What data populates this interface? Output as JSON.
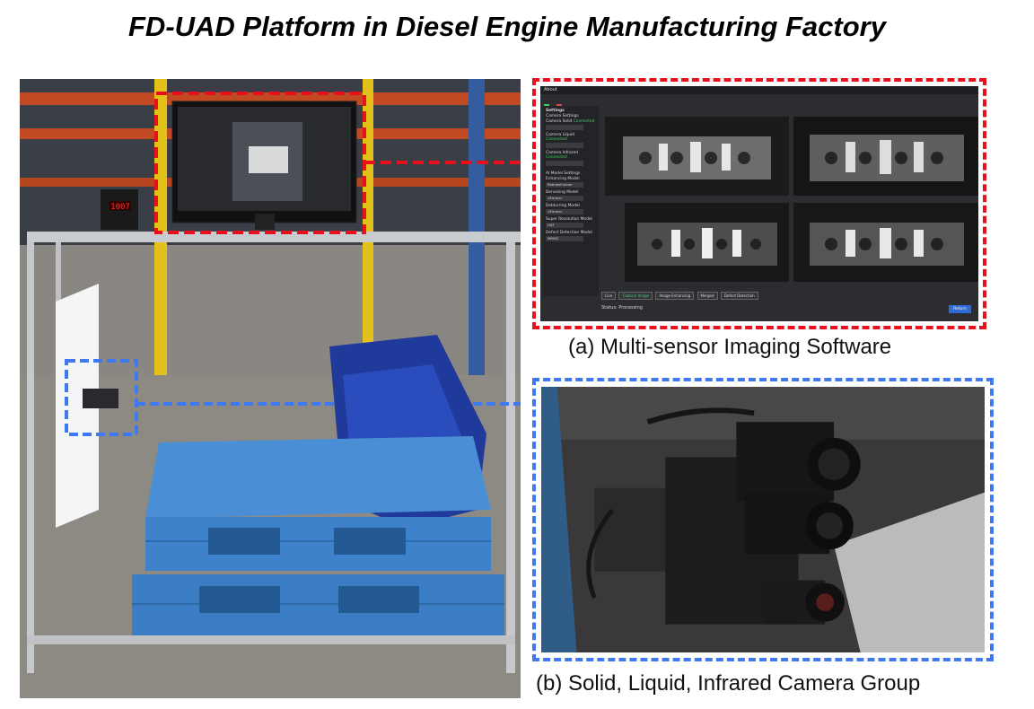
{
  "title": "FD-UAD Platform in Diesel Engine Manufacturing Factory",
  "captions": {
    "a": "(a) Multi-sensor Imaging Software",
    "b": "(b) Solid, Liquid, Infrared Camera Group"
  },
  "software": {
    "window_title": "About",
    "settings_header": "Settings",
    "camera_settings_header": "Camera Settings",
    "cameras": [
      {
        "label": "Camera Solid",
        "state": "Connected"
      },
      {
        "label": "Camera Liquid",
        "state": "Connected"
      },
      {
        "label": "Camera Infrared",
        "state": "Connected"
      }
    ],
    "ai_settings_header": "AI Model Settings",
    "models": [
      {
        "label": "Enhancing Model",
        "value": "RetinexFormer"
      },
      {
        "label": "Denoising Model",
        "value": "UFormer"
      },
      {
        "label": "Deblurring Model",
        "value": "UFormer"
      },
      {
        "label": "Super Resolution Model",
        "value": "HAT"
      },
      {
        "label": "Defect Detection Model",
        "value": "MMMC"
      }
    ],
    "buttons": [
      "Live",
      "Capture Image",
      "Image Enhancing",
      "Merged",
      "Defect Detection"
    ],
    "status_label": "Status:",
    "status_value": "Processing",
    "return_label": "Return"
  },
  "device_display": "1007",
  "colors": {
    "red_box": "#e8101c",
    "blue_box": "#3f78f0",
    "pallet": "#4a8fd6",
    "engine_block": "#1f3a9a"
  }
}
